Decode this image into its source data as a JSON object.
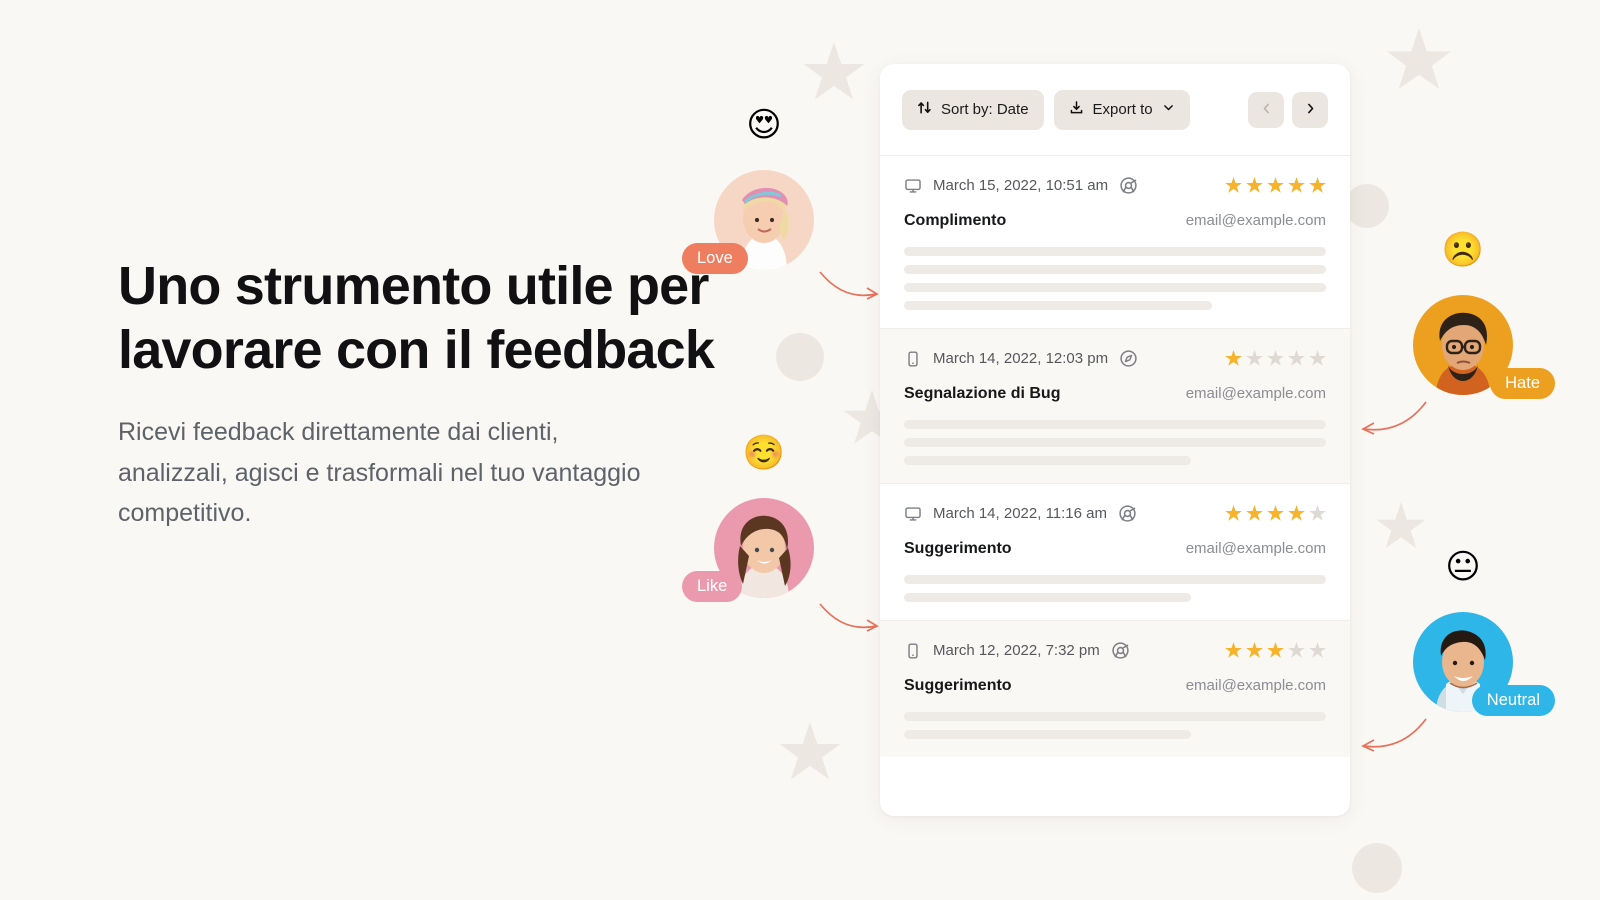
{
  "hero": {
    "headline": "Uno strumento utile per lavorare con il feedback",
    "subtitle": "Ricevi feedback direttamente dai clienti, analizzali, agisci e trasformali nel tuo vantaggio competitivo."
  },
  "personas": [
    {
      "label": "Love",
      "emoji": "😍",
      "badge_color": "#ef7d5f",
      "ring_color": "#f6d7c6"
    },
    {
      "label": "Like",
      "emoji": "☺️",
      "badge_color": "#eb9aae",
      "ring_color": "#eb9aae"
    },
    {
      "label": "Hate",
      "emoji": "☹️",
      "badge_color": "#eda01f",
      "ring_color": "#eda01f"
    },
    {
      "label": "Neutral",
      "emoji": "😐",
      "badge_color": "#2fb6e8",
      "ring_color": "#2fb6e8"
    }
  ],
  "card": {
    "toolbar": {
      "sort_label": "Sort by: Date",
      "sort_icon": "sort-arrows-icon",
      "export_label": "Export to",
      "export_icon": "download-icon",
      "export_caret_icon": "chevron-down-icon",
      "prev_icon": "chevron-left-icon",
      "next_icon": "chevron-right-icon"
    },
    "rows": [
      {
        "device_icon": "desktop-icon",
        "date": "March 15, 2022, 10:51 am",
        "browser_icon": "chrome-icon",
        "rating": 5,
        "max_rating": 5,
        "title": "Complimento",
        "email": "email@example.com",
        "skeleton_widths": [
          "100%",
          "100%",
          "100%",
          "73%"
        ]
      },
      {
        "device_icon": "mobile-icon",
        "date": "March 14, 2022, 12:03 pm",
        "browser_icon": "safari-icon",
        "rating": 1,
        "max_rating": 5,
        "title": "Segnalazione di Bug",
        "email": "email@example.com",
        "skeleton_widths": [
          "100%",
          "100%",
          "68%"
        ]
      },
      {
        "device_icon": "desktop-icon",
        "date": "March 14, 2022, 11:16 am",
        "browser_icon": "chrome-icon",
        "rating": 4,
        "max_rating": 5,
        "title": "Suggerimento",
        "email": "email@example.com",
        "skeleton_widths": [
          "100%",
          "68%"
        ]
      },
      {
        "device_icon": "mobile-icon",
        "date": "March 12, 2022, 7:32 pm",
        "browser_icon": "chrome-icon",
        "rating": 3,
        "max_rating": 5,
        "title": "Suggerimento",
        "email": "email@example.com",
        "skeleton_widths": [
          "100%",
          "68%"
        ]
      }
    ]
  },
  "colors": {
    "page_background": "#faf8f5",
    "card_background": "#ffffff",
    "star_filled": "#f7b32b",
    "star_empty": "#dedad3",
    "decoration": "#ece8e1",
    "arrow": "#e8715a"
  }
}
